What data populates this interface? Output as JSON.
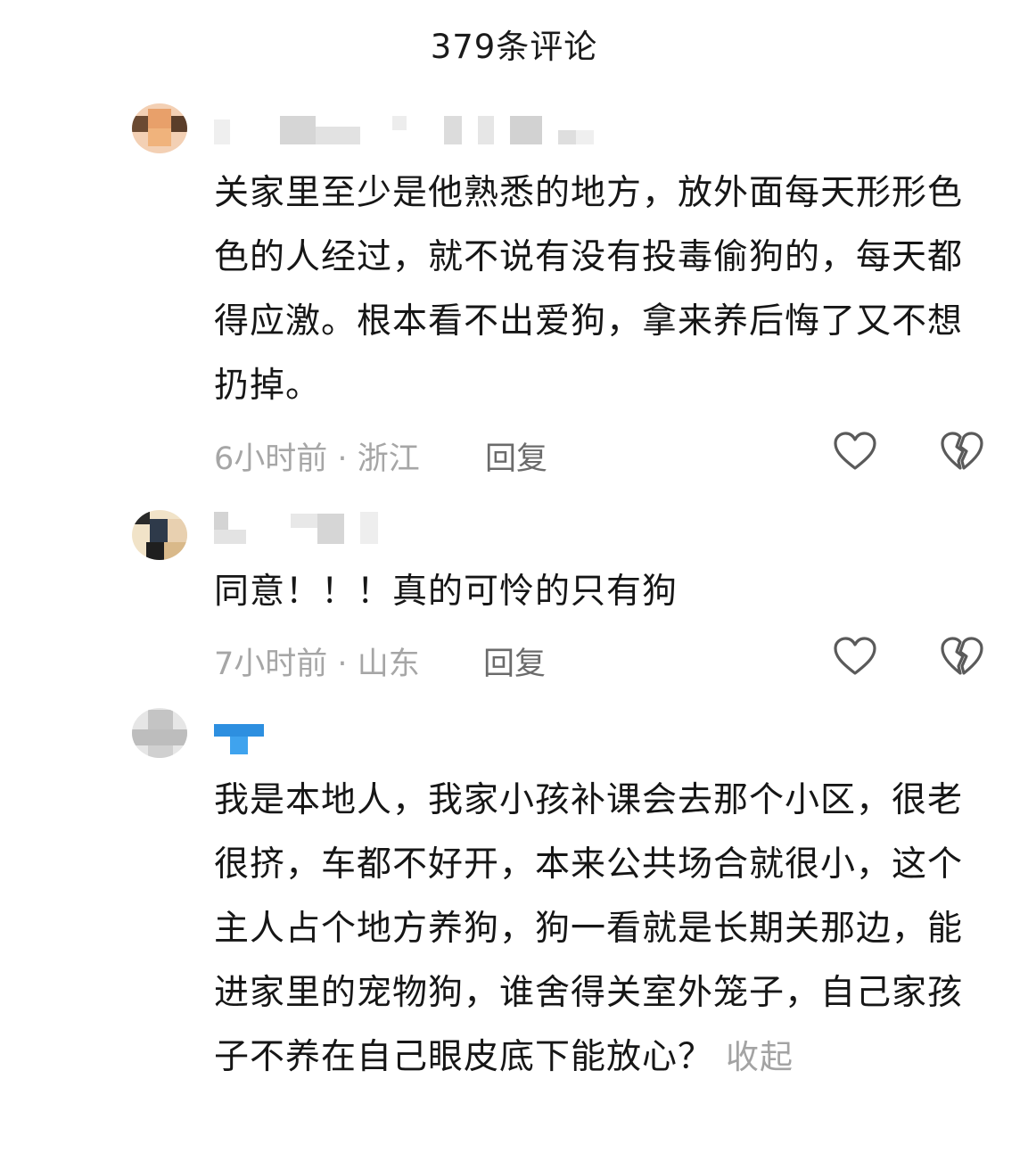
{
  "header": {
    "title": "379条评论"
  },
  "comments": [
    {
      "text": "关家里至少是他熟悉的地方，放外面每天形形色色的人经过，就不说有没有投毒偷狗的，每天都得应激。根本看不出爱狗，拿来养后悔了又不想扔掉。",
      "time": "6小时前",
      "location": "浙江",
      "reply_label": "回复"
    },
    {
      "text": "同意！！！真的可怜的只有狗",
      "time": "7小时前",
      "location": "山东",
      "reply_label": "回复"
    },
    {
      "text": "我是本地人，我家小孩补课会去那个小区，很老很挤，车都不好开，本来公共场合就很小，这个主人占个地方养狗，狗一看就是长期关那边，能进家里的宠物狗，谁舍得关室外笼子，自己家孩子不养在自己眼皮底下能放心？",
      "collapse_label": "收起"
    }
  ],
  "icons": {
    "like": "heart-outline-icon",
    "dislike": "broken-heart-icon"
  },
  "colors": {
    "meta": "#a6a6a6",
    "reply": "#6b6b6b",
    "icon": "#5a5a5a"
  }
}
